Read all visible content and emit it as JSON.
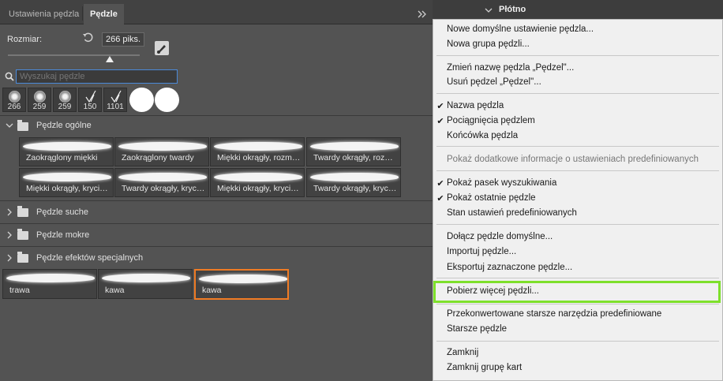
{
  "tabs": [
    "Ustawienia pędzla",
    "Pędzle"
  ],
  "size": {
    "label": "Rozmiar:",
    "value": "266 piks."
  },
  "search": {
    "placeholder": "Wyszukaj pędzle"
  },
  "recent_brushes": [
    "266",
    "259",
    "259",
    "150",
    "1101"
  ],
  "groups": {
    "general": {
      "label": "Pędzle ogólne",
      "brushes": [
        "Zaokrąglony miękki",
        "Zaokrąglony twardy",
        "Miękki okrągły, rozmia...",
        "Twardy okrągły, rozmi...",
        "Miękki okrągły, krycie...",
        "Twardy okrągły, krycie...",
        "Miękki okrągły, krycie...",
        "Twardy okrągły, krycie..."
      ]
    },
    "dry": {
      "label": "Pędzle suche"
    },
    "wet": {
      "label": "Pędzle mokre"
    },
    "special": {
      "label": "Pędzle efektów specjalnych"
    }
  },
  "custom_brushes": [
    "trawa",
    "kawa",
    "kawa"
  ],
  "dock": {
    "title": "Płótno"
  },
  "menu": {
    "new_preset": "Nowe domyślne ustawienie pędzla...",
    "new_group": "Nowa grupa pędzli...",
    "rename": "Zmień nazwę pędzla „Pędzel\"...",
    "delete": "Usuń pędzel „Pędzel\"...",
    "brush_name": "Nazwa pędzla",
    "brush_strokes": "Pociągnięcia pędzlem",
    "brush_tip": "Końcówka pędzla",
    "show_more_info": "Pokaż dodatkowe informacje o ustawieniach predefiniowanych",
    "show_search": "Pokaż pasek wyszukiwania",
    "show_recent": "Pokaż ostatnie pędzle",
    "preset_state": "Stan ustawień predefiniowanych",
    "append_default": "Dołącz pędzle domyślne...",
    "import": "Importuj pędzle...",
    "export": "Eksportuj zaznaczone pędzle...",
    "get_more": "Pobierz więcej pędzli...",
    "converted_legacy": "Przekonwertowane starsze narzędzia predefiniowane",
    "legacy": "Starsze pędzle",
    "close": "Zamknij",
    "close_group": "Zamknij grupę kart"
  },
  "colors": {
    "highlight": "#7ee02b",
    "selected_border": "#f07b24",
    "search_border": "#4b8ad9"
  }
}
